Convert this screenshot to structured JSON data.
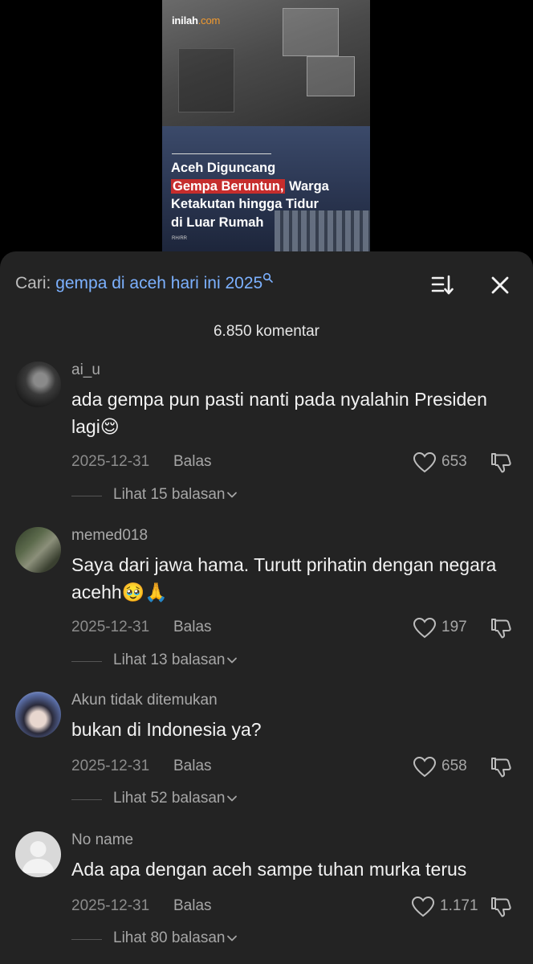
{
  "video": {
    "logo_main": "inilah",
    "logo_suffix": ".com",
    "headline_line1": "Aceh Diguncang",
    "headline_highlight": "Gempa Beruntun,",
    "headline_rest1": " Warga",
    "headline_line3": "Ketakutan hingga Tidur",
    "headline_line4": "di Luar Rumah",
    "credit": "RH/RR"
  },
  "search": {
    "prefix": "Cari: ",
    "query": "gempa di aceh hari ini 2025"
  },
  "comment_count": "6.850 komentar",
  "comments": [
    {
      "username": "ai_u",
      "text": "ada gempa pun pasti nanti pada nyalahin Presiden lagi😌",
      "date": "2025-12-31",
      "reply": "Balas",
      "likes": "653",
      "view_replies": "Lihat 15 balasan"
    },
    {
      "username": "memed018",
      "text": "Saya dari jawa hama. Turutt prihatin dengan negara acehh🥹🙏",
      "date": "2025-12-31",
      "reply": "Balas",
      "likes": "197",
      "view_replies": "Lihat 13 balasan"
    },
    {
      "username": "Akun tidak ditemukan",
      "text": "bukan di Indonesia ya?",
      "date": "2025-12-31",
      "reply": "Balas",
      "likes": "658",
      "view_replies": "Lihat 52 balasan"
    },
    {
      "username": "No name",
      "text": "Ada apa dengan aceh sampe tuhan murka terus",
      "date": "2025-12-31",
      "reply": "Balas",
      "likes": "1.171",
      "view_replies": "Lihat 80 balasan"
    }
  ],
  "icons": {
    "sort": "sort-icon",
    "close": "close-icon",
    "search_mini": "search-icon",
    "like": "heart-icon",
    "dislike": "thumbs-down-icon",
    "chevron": "chevron-down-icon"
  },
  "colors": {
    "panel_bg": "#232323",
    "query_link": "#7cb1ff",
    "headline_highlight": "#c62d2d"
  }
}
